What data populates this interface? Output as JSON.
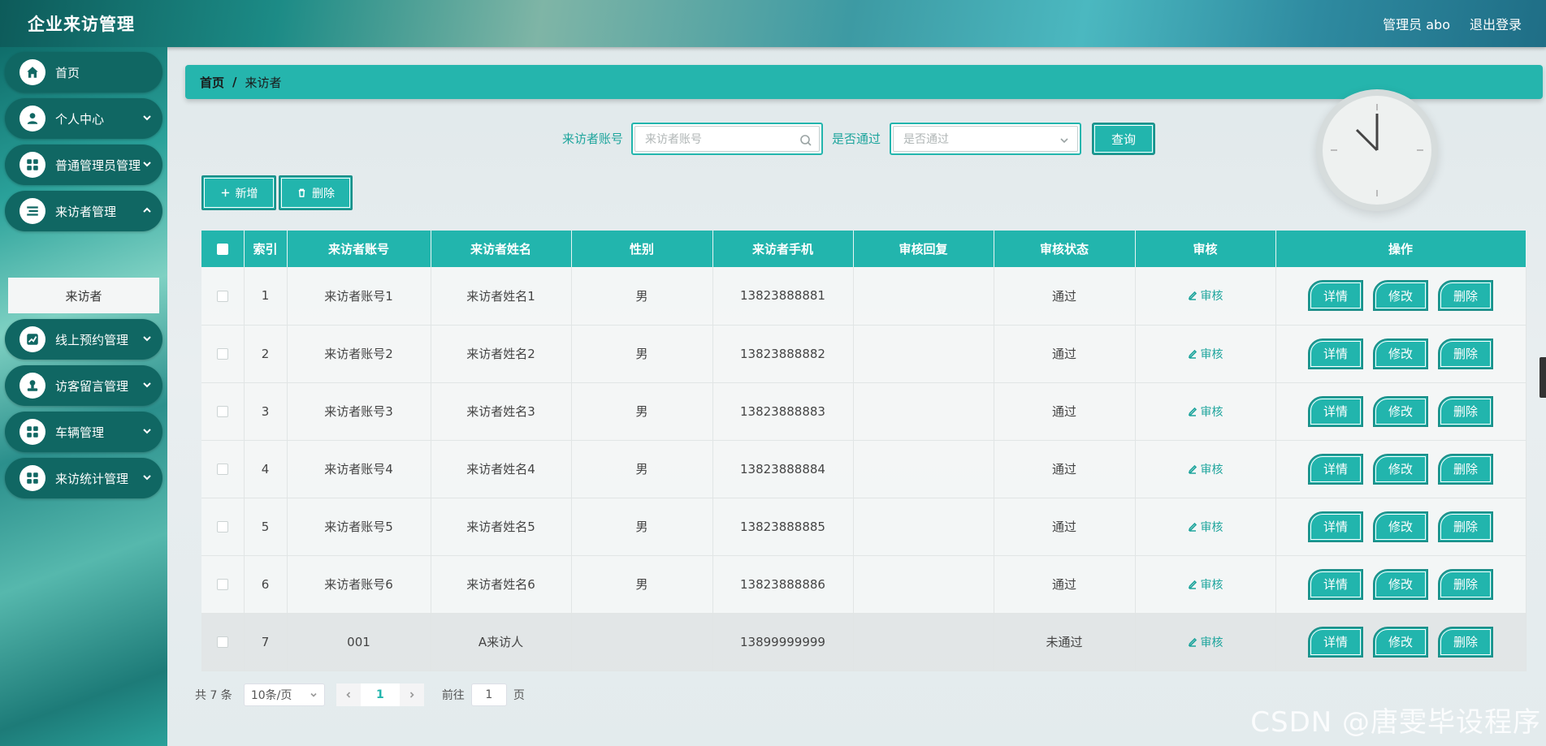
{
  "app": {
    "title": "企业来访管理"
  },
  "header": {
    "user_label": "管理员 abo",
    "logout_label": "退出登录"
  },
  "sidebar": {
    "items": [
      {
        "label": "首页",
        "icon": "home-icon"
      },
      {
        "label": "个人中心",
        "icon": "user-icon"
      },
      {
        "label": "普通管理员管理",
        "icon": "grid-icon"
      },
      {
        "label": "来访者管理",
        "icon": "list-icon"
      },
      {
        "label": "线上预约管理",
        "icon": "chart-icon"
      },
      {
        "label": "访客留言管理",
        "icon": "stamp-icon"
      },
      {
        "label": "车辆管理",
        "icon": "grid-icon"
      },
      {
        "label": "来访统计管理",
        "icon": "grid-icon"
      }
    ],
    "submenu_active": "来访者"
  },
  "breadcrumb": {
    "home": "首页",
    "separator": "/",
    "current": "来访者"
  },
  "search": {
    "account_label": "来访者账号",
    "account_placeholder": "来访者账号",
    "passed_label": "是否通过",
    "passed_placeholder": "是否通过",
    "query_button": "查询"
  },
  "actions": {
    "add_label": "新增",
    "delete_label": "删除"
  },
  "table": {
    "columns": [
      "索引",
      "来访者账号",
      "来访者姓名",
      "性别",
      "来访者手机",
      "审核回复",
      "审核状态",
      "审核",
      "操作"
    ],
    "audit_link": "审核",
    "op_detail": "详情",
    "op_edit": "修改",
    "op_delete": "删除",
    "rows": [
      {
        "index": "1",
        "account": "来访者账号1",
        "name": "来访者姓名1",
        "gender": "男",
        "phone": "13823888881",
        "reply": "",
        "status": "通过"
      },
      {
        "index": "2",
        "account": "来访者账号2",
        "name": "来访者姓名2",
        "gender": "男",
        "phone": "13823888882",
        "reply": "",
        "status": "通过"
      },
      {
        "index": "3",
        "account": "来访者账号3",
        "name": "来访者姓名3",
        "gender": "男",
        "phone": "13823888883",
        "reply": "",
        "status": "通过"
      },
      {
        "index": "4",
        "account": "来访者账号4",
        "name": "来访者姓名4",
        "gender": "男",
        "phone": "13823888884",
        "reply": "",
        "status": "通过"
      },
      {
        "index": "5",
        "account": "来访者账号5",
        "name": "来访者姓名5",
        "gender": "男",
        "phone": "13823888885",
        "reply": "",
        "status": "通过"
      },
      {
        "index": "6",
        "account": "来访者账号6",
        "name": "来访者姓名6",
        "gender": "男",
        "phone": "13823888886",
        "reply": "",
        "status": "通过"
      },
      {
        "index": "7",
        "account": "001",
        "name": "A来访人",
        "gender": "",
        "phone": "13899999999",
        "reply": "",
        "status": "未通过"
      }
    ]
  },
  "pagination": {
    "total": "共 7 条",
    "page_size": "10条/页",
    "current_page": "1",
    "goto_label": "前往",
    "goto_value": "1",
    "goto_suffix": "页"
  },
  "watermark": "CSDN @唐雯毕设程序",
  "colors": {
    "accent": "#22b5ad",
    "sidebar_item": "#106763",
    "link": "#1fa59d"
  }
}
